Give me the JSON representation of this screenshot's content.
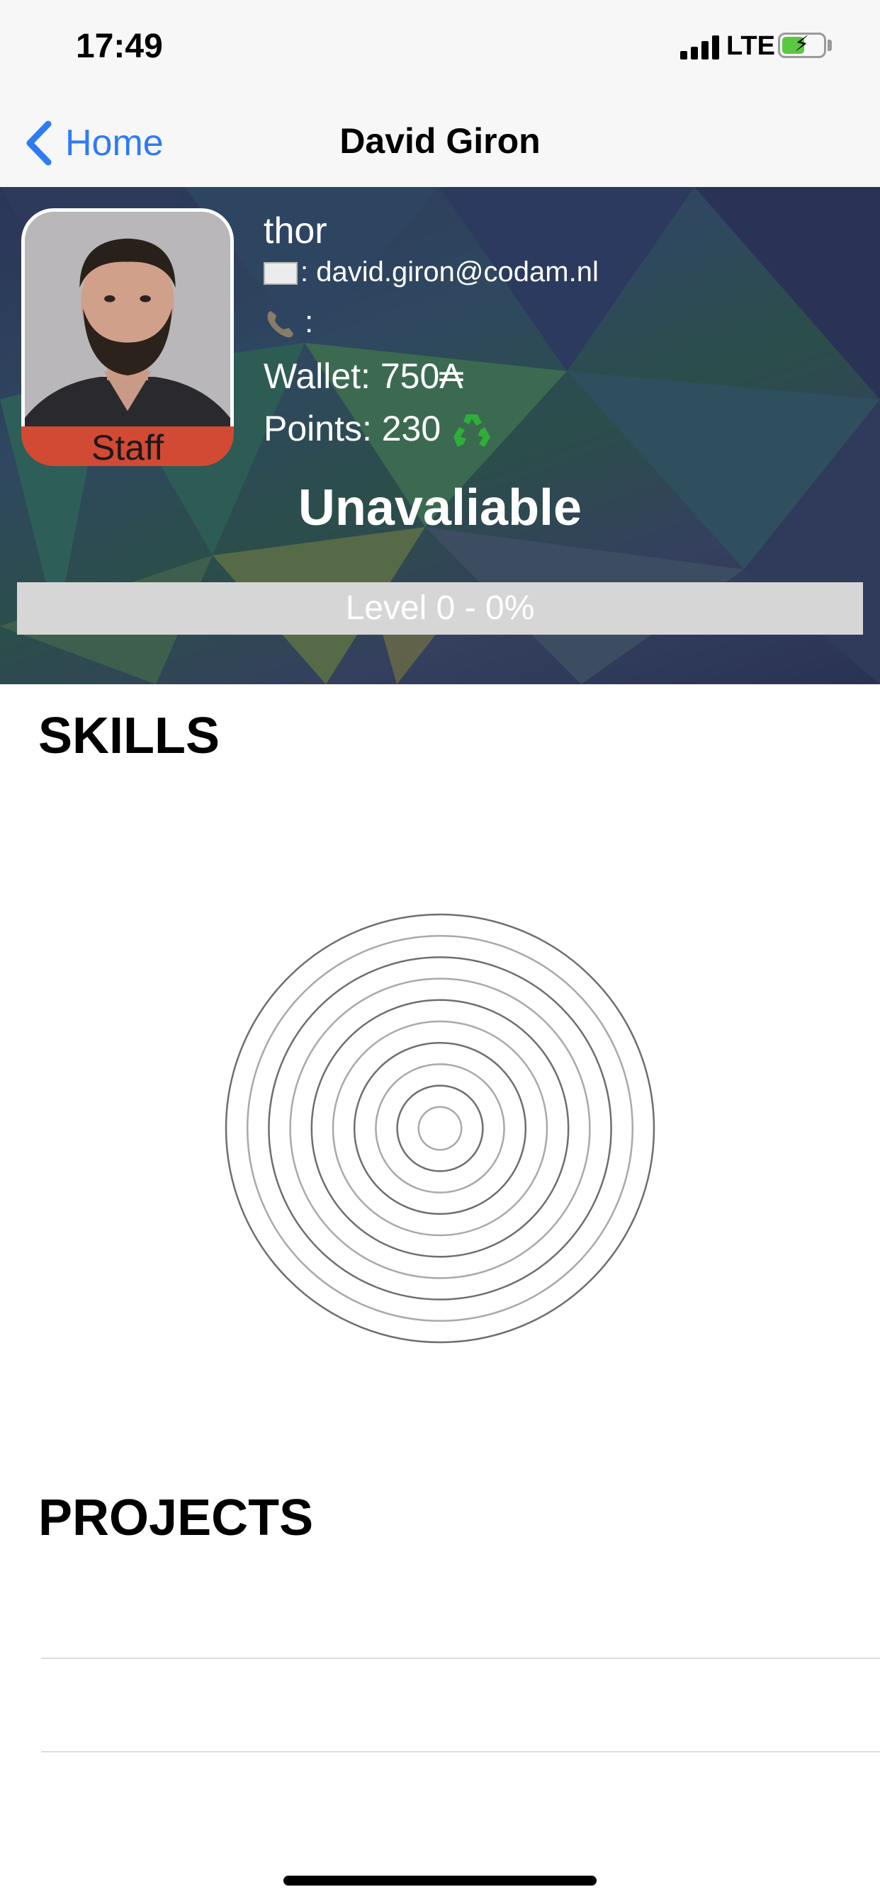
{
  "status_bar": {
    "time": "17:49",
    "network": "LTE",
    "battery_level": 0.55,
    "battery_charging": true
  },
  "nav": {
    "back_label": "Home",
    "title": "David Giron"
  },
  "profile": {
    "login": "thor",
    "email_sep": ": ",
    "email": "david.giron@codam.nl",
    "phone_label": ":",
    "wallet_label": "Wallet: ",
    "wallet_value": "750",
    "wallet_currency": "₳",
    "points_label": "Points: ",
    "points_value": "230",
    "badge": "Staff",
    "status": "Unavaliable",
    "level_text": "Level 0 - 0%",
    "level_progress": 0
  },
  "sections": {
    "skills": "SKILLS",
    "projects": "PROJECTS"
  },
  "skills_chart": {
    "rings": 10
  },
  "colors": {
    "accent": "#2f7bf5",
    "badge": "#d24a34",
    "level_bar": "#d6d6d6"
  }
}
